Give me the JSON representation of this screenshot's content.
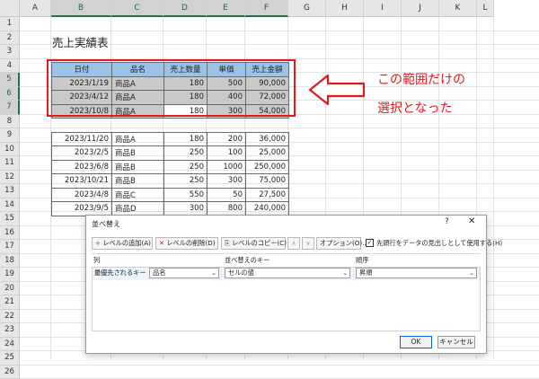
{
  "sheet": {
    "columns": [
      "A",
      "B",
      "C",
      "D",
      "E",
      "F",
      "G",
      "H",
      "I",
      "J",
      "K",
      "L"
    ],
    "rows": [
      "1",
      "2",
      "3",
      "4",
      "5",
      "6",
      "7",
      "8",
      "9",
      "10",
      "11",
      "12",
      "13",
      "14",
      "15",
      "16",
      "17",
      "18",
      "19",
      "20",
      "21",
      "22",
      "23",
      "24",
      "25",
      "26"
    ],
    "title": "売上実績表",
    "table": {
      "headers": [
        "日付",
        "品名",
        "売上数量",
        "単価",
        "売上金額"
      ],
      "rows": [
        [
          "2023/1/19",
          "商品A",
          "180",
          "500",
          "90,000"
        ],
        [
          "2023/4/12",
          "商品A",
          "180",
          "400",
          "72,000"
        ],
        [
          "2023/10/8",
          "商品A",
          "180",
          "300",
          "54,000"
        ],
        [
          "2023/11/20",
          "商品A",
          "180",
          "200",
          "36,000"
        ],
        [
          "2023/2/5",
          "商品B",
          "250",
          "100",
          "25,000"
        ],
        [
          "2023/6/8",
          "商品B",
          "250",
          "1000",
          "250,000"
        ],
        [
          "2023/10/21",
          "商品B",
          "250",
          "300",
          "75,000"
        ],
        [
          "2023/4/8",
          "商品C",
          "550",
          "50",
          "27,500"
        ],
        [
          "2023/9/5",
          "商品D",
          "300",
          "800",
          "240,000"
        ]
      ]
    }
  },
  "annotation": {
    "line1": "この範囲だけの",
    "line2": "選択となった",
    "color": "#e01b1b"
  },
  "dialog": {
    "title": "並べ替え",
    "help": "?",
    "close": "✕",
    "toolbar": {
      "add": "レベルの追加(A)",
      "delete": "レベルの削除(D)",
      "copy": "レベルのコピー(C)",
      "up": "∧",
      "down": "∨",
      "options": "オプション(O)...",
      "header_checkbox": "先頭行をデータの見出しとして使用する(H)"
    },
    "columns": {
      "col": "列",
      "sort_on": "並べ替えのキー",
      "order": "順序"
    },
    "level": {
      "label": "最優先されるキー",
      "column": "品名",
      "sort_on": "セルの値",
      "order": "昇順"
    },
    "ok": "OK",
    "cancel": "キャンセル"
  }
}
